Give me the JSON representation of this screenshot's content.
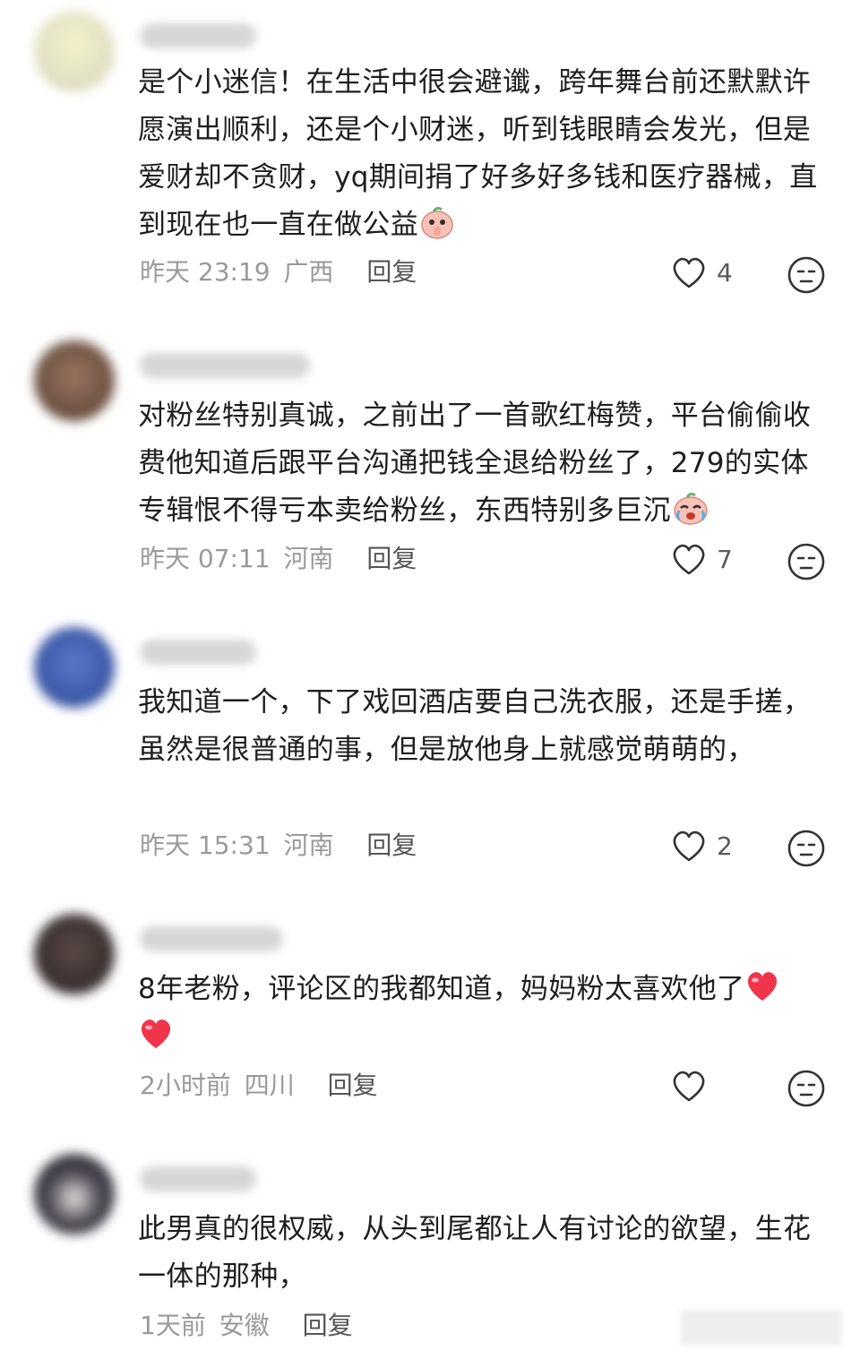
{
  "comments": [
    {
      "avatar_color": "#e9e7c8",
      "text": "是个小迷信！在生活中很会避谶，跨年舞台前还默默许愿演出顺利，还是个小财迷，听到钱眼睛会发光，但是爱财却不贪财，yq期间捐了好多好多钱和医疗器械，直到现在也一直在做公益",
      "time": "昨天 23:19",
      "location": "广西",
      "reply_label": "回复",
      "likes": "4"
    },
    {
      "avatar_color": "#8a6a55",
      "text": "对粉丝特别真诚，之前出了一首歌红梅赞，平台偷偷收费他知道后跟平台沟通把钱全退给粉丝了，279的实体专辑恨不得亏本卖给粉丝，东西特别多巨沉",
      "time": "昨天 07:11",
      "location": "河南",
      "reply_label": "回复",
      "likes": "7"
    },
    {
      "avatar_color": "#3c5aa8",
      "text": "我知道一个，下了戏回酒店要自己洗衣服，还是手搓，虽然是很普通的事，但是放他身上就感觉萌萌的，",
      "time": "昨天 15:31",
      "location": "河南",
      "reply_label": "回复",
      "likes": "2"
    },
    {
      "avatar_color": "#3a3030",
      "text": "8年老粉，评论区的我都知道，妈妈粉太喜欢他了",
      "time": "2小时前",
      "location": "四川",
      "reply_label": "回复",
      "likes": ""
    },
    {
      "avatar_color": "#2e2e34",
      "text": "此男真的很权威，从头到尾都让人有讨论的欲望，生花一体的那种，",
      "time": "1天前",
      "location": "安徽",
      "reply_label": "回复",
      "likes": ""
    }
  ],
  "icons": {
    "like": "heart-outline-icon",
    "dislike": "neutral-face-icon"
  },
  "colors": {
    "meta_text": "#9a9a9a",
    "body_text": "#1e1e1e",
    "heart_emoji": "#f0344c"
  }
}
